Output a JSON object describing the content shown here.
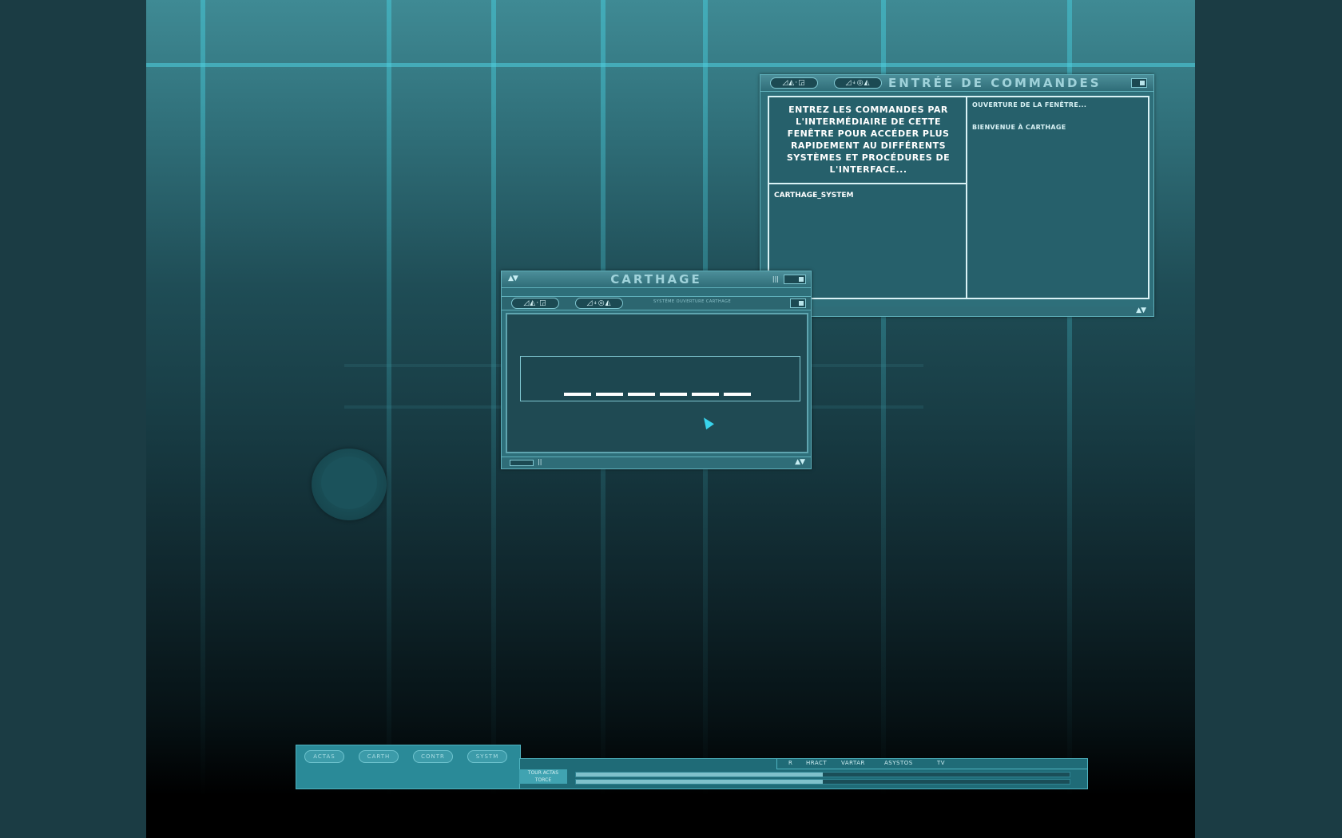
{
  "command_window": {
    "title": "ENTRÉE DE COMMANDES",
    "pill_left": "◿◭·◲",
    "pill_right": "◿⍖◎◭",
    "help_text": "ENTREZ LES COMMANDES PAR L'INTERMÉDIAIRE DE CETTE FENÊTRE POUR ACCÉDER PLUS RAPIDEMENT AU DIFFÉRENTS SYSTÈMES ET PROCÉDURES DE L'INTERFACE...",
    "command_input_value": "CARTHAGE_SYSTEM",
    "output_lines": [
      "OUVERTURE DE LA FENÊTRE...",
      "BIENVENUE À CARTHAGE"
    ]
  },
  "carthage_window": {
    "title": "CARTHAGE",
    "pill_left": "◿◭·◲",
    "pill_right": "◿⍖◎◭",
    "subtitle": "SYSTÈME OUVERTURE CARTHAGE",
    "password_value": "••••••"
  },
  "taskbar": {
    "buttons": [
      "ACTAS",
      "CARTH",
      "CONTR",
      "SYSTM"
    ],
    "label_line1": "TOUR ACTAS",
    "label_line2": "TORCE",
    "system_items": [
      "R",
      "HRACT",
      "VARTAR",
      "ASYSTOS",
      "TV"
    ],
    "progress": [
      0.5,
      0.5
    ]
  }
}
